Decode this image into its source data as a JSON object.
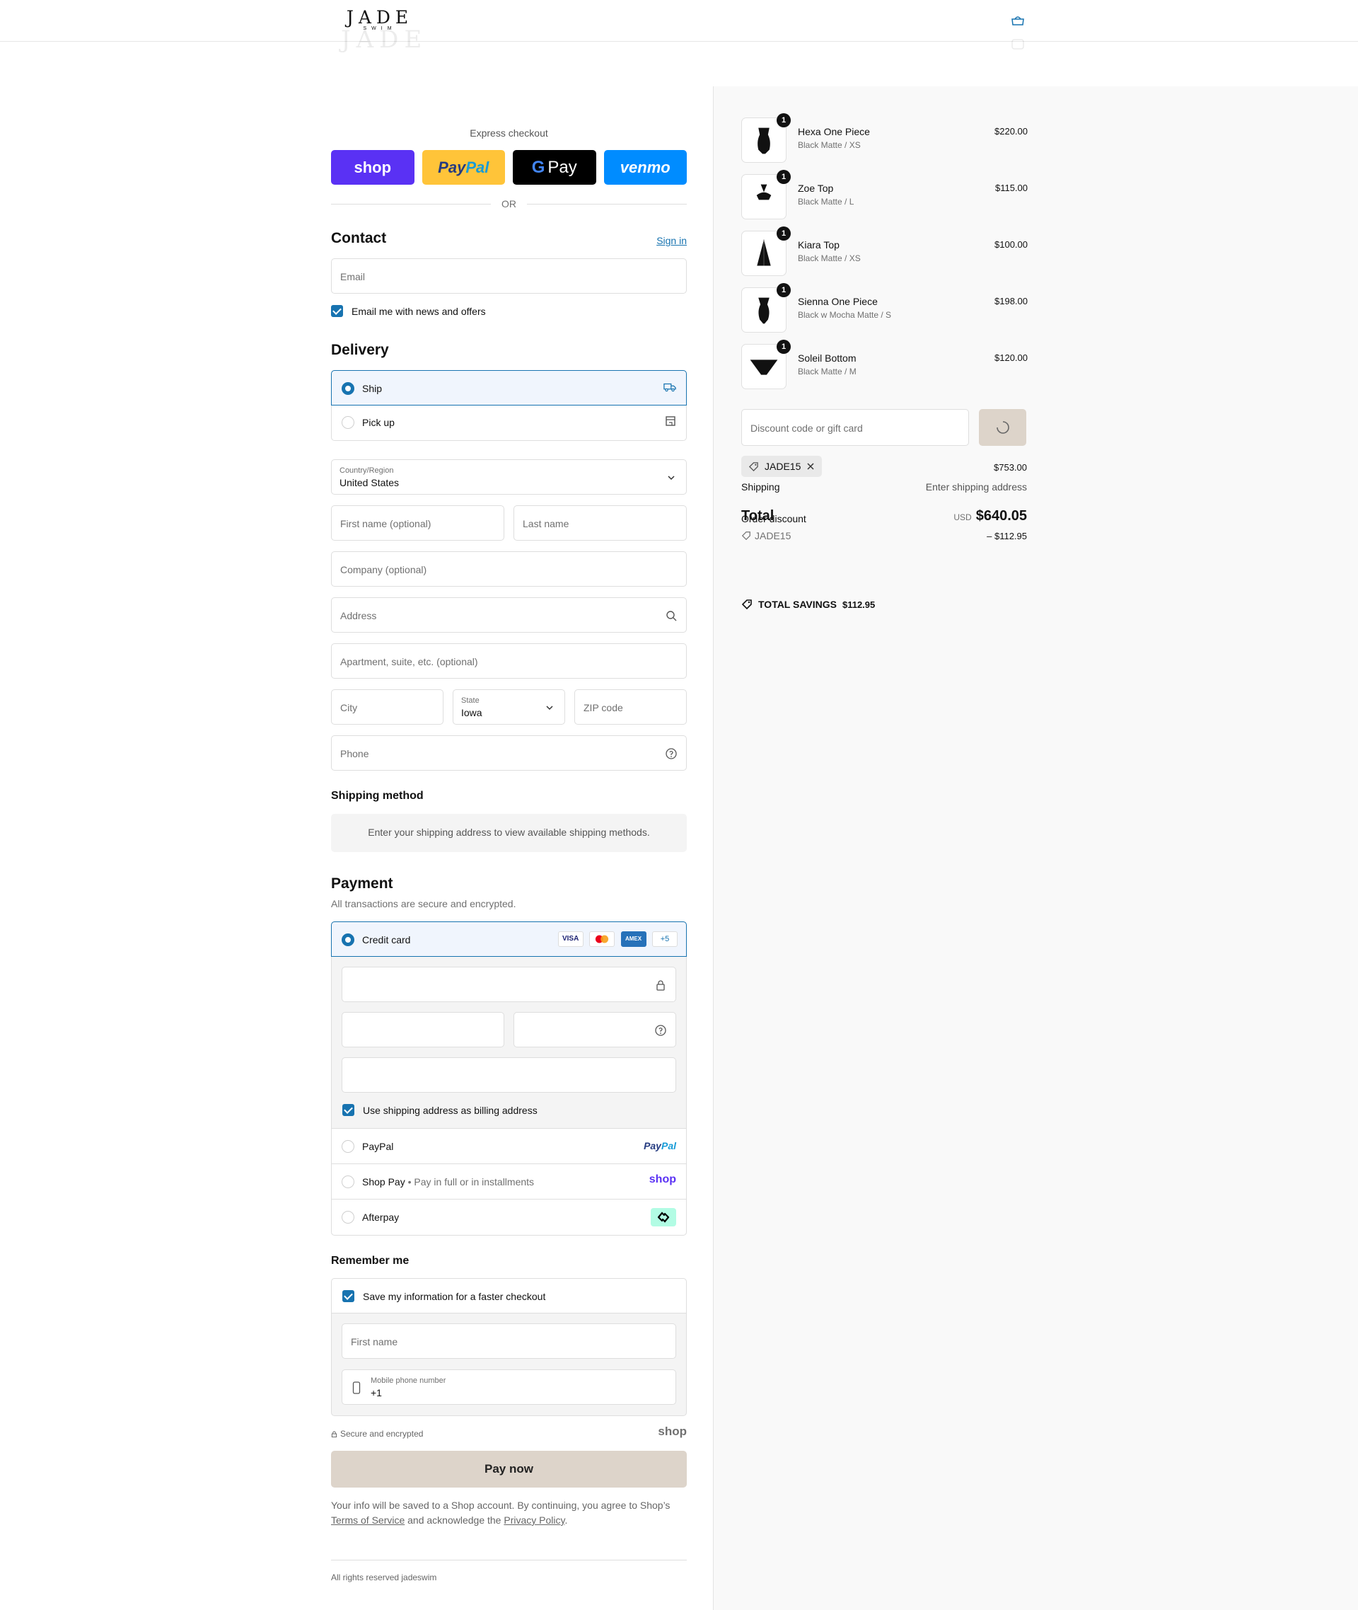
{
  "brand": {
    "name": "JADE",
    "tagline": "SWIM"
  },
  "express": {
    "title": "Express checkout",
    "shop": "shop",
    "paypal_a": "Pay",
    "paypal_b": "Pal",
    "gpay_g": "G",
    "gpay_label": "Pay",
    "venmo": "venmo",
    "or": "OR"
  },
  "contact": {
    "heading": "Contact",
    "signin": "Sign in",
    "email_placeholder": "Email",
    "news_label": "Email me with news and offers"
  },
  "delivery": {
    "heading": "Delivery",
    "ship": "Ship",
    "pickup": "Pick up",
    "country_label": "Country/Region",
    "country_value": "United States",
    "first_name": "First name (optional)",
    "last_name": "Last name",
    "company": "Company (optional)",
    "address": "Address",
    "apartment": "Apartment, suite, etc. (optional)",
    "city": "City",
    "state_label": "State",
    "state_value": "Iowa",
    "zip": "ZIP code",
    "phone": "Phone"
  },
  "shipping_method": {
    "heading": "Shipping method",
    "info": "Enter your shipping address to view available shipping methods."
  },
  "payment": {
    "heading": "Payment",
    "subtitle": "All transactions are secure and encrypted.",
    "credit_card": "Credit card",
    "cards": [
      "VISA",
      "",
      "AMEX",
      "+5"
    ],
    "billing_same": "Use shipping address as billing address",
    "paypal": "PayPal",
    "paypal_logo_a": "Pay",
    "paypal_logo_b": "Pal",
    "shoppay": "Shop Pay",
    "shoppay_sub": "Pay in full or in installments",
    "shoppay_logo": "shop",
    "afterpay": "Afterpay"
  },
  "remember": {
    "heading": "Remember me",
    "save_label": "Save my information for a faster checkout",
    "first_name": "First name",
    "mobile_label": "Mobile phone number",
    "mobile_value": "+1",
    "secure": "Secure and encrypted",
    "shop_logo": "shop"
  },
  "pay_now": "Pay now",
  "legal": {
    "part1": "Your info will be saved to a Shop account. By continuing, you agree to Shop’s",
    "terms": "Terms of Service",
    "part2": "and acknowledge the",
    "privacy": "Privacy Policy",
    "part3": "."
  },
  "footer": "All rights reserved jadeswim",
  "summary": {
    "items": [
      {
        "name": "Hexa One Piece",
        "variant": "Black Matte / XS",
        "price": "$220.00",
        "qty": "1"
      },
      {
        "name": "Zoe Top",
        "variant": "Black Matte / L",
        "price": "$115.00",
        "qty": "1"
      },
      {
        "name": "Kiara Top",
        "variant": "Black Matte / XS",
        "price": "$100.00",
        "qty": "1"
      },
      {
        "name": "Sienna One Piece",
        "variant": "Black w Mocha Matte / S",
        "price": "$198.00",
        "qty": "1"
      },
      {
        "name": "Soleil Bottom",
        "variant": "Black Matte / M",
        "price": "$120.00",
        "qty": "1"
      }
    ],
    "discount_placeholder": "Discount code or gift card",
    "applied_code": "JADE15",
    "subtotal": "$753.00",
    "shipping_label": "Shipping",
    "shipping_value": "Enter shipping address",
    "total_label": "Total",
    "order_discount_label": "Order discount",
    "currency": "USD",
    "total_value": "$640.05",
    "discount_code": "JADE15",
    "discount_value": "– $112.95",
    "savings_label": "TOTAL SAVINGS",
    "savings_value": "$112.95"
  }
}
